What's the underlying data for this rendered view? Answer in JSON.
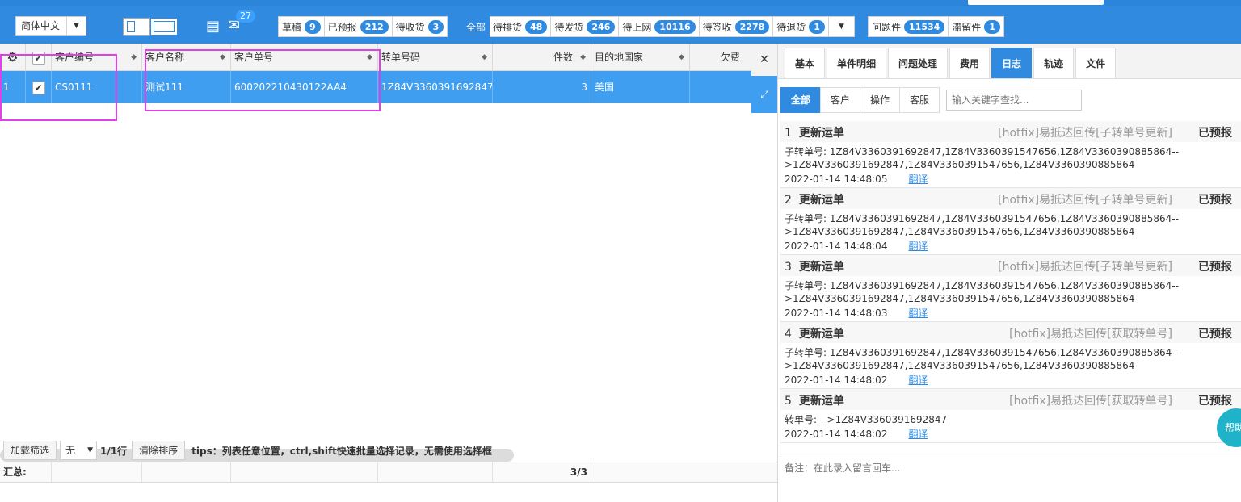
{
  "toolbar": {
    "language": "简体中文",
    "mail_count": "27",
    "group1": [
      {
        "label": "草稿",
        "count": "9"
      },
      {
        "label": "已预报",
        "count": "212"
      },
      {
        "label": "待收货",
        "count": "3"
      }
    ],
    "group2": [
      {
        "label": "全部",
        "count": ""
      },
      {
        "label": "待排货",
        "count": "48"
      },
      {
        "label": "待发货",
        "count": "246"
      },
      {
        "label": "待上网",
        "count": "10116"
      },
      {
        "label": "待签收",
        "count": "2278"
      },
      {
        "label": "待退货",
        "count": "1"
      }
    ],
    "group3": [
      {
        "label": "问题件",
        "count": "11534"
      },
      {
        "label": "滞留件",
        "count": "1"
      }
    ]
  },
  "grid": {
    "columns": [
      "客户编号",
      "客户名称",
      "客户单号",
      "转单号码",
      "件数",
      "目的地国家",
      "欠费"
    ],
    "row": {
      "index": "1",
      "customer_code": "CS0111",
      "customer_name": "测试111",
      "customer_order": "600202210430122AA4",
      "transfer_no": "1Z84V3360391692847",
      "pieces": "3",
      "country": "美国",
      "arrears": ""
    }
  },
  "bottom": {
    "load_filter": "加载筛选",
    "filter_value": "无",
    "row_count": "1/1行",
    "clear_sort": "清除排序",
    "tips": "tips：列表任意位置，ctrl,shift快速批量选择记录，无需使用选择框",
    "summary_label": "汇总:",
    "summary_pieces": "3/3"
  },
  "panel": {
    "tabs": [
      "基本",
      "单件明细",
      "问题处理",
      "费用",
      "日志",
      "轨迹",
      "文件"
    ],
    "active_tab": "日志",
    "subtabs": [
      "全部",
      "客户",
      "操作",
      "客服"
    ],
    "keyword_placeholder": "输入关键字查找...",
    "logs": [
      {
        "num": "1",
        "title": "更新运单",
        "op": "[hotfix]易抵达回传[子转单号更新]",
        "status": "已预报",
        "body": "子转单号: 1Z84V3360391692847,1Z84V3360391547656,1Z84V3360390885864-->1Z84V3360391692847,1Z84V3360391547656,1Z84V3360390885864",
        "time": "2022-01-14 14:48:05",
        "translate": "翻译"
      },
      {
        "num": "2",
        "title": "更新运单",
        "op": "[hotfix]易抵达回传[子转单号更新]",
        "status": "已预报",
        "body": "子转单号: 1Z84V3360391692847,1Z84V3360391547656,1Z84V3360390885864-->1Z84V3360391692847,1Z84V3360391547656,1Z84V3360390885864",
        "time": "2022-01-14 14:48:04",
        "translate": "翻译"
      },
      {
        "num": "3",
        "title": "更新运单",
        "op": "[hotfix]易抵达回传[子转单号更新]",
        "status": "已预报",
        "body": "子转单号: 1Z84V3360391692847,1Z84V3360391547656,1Z84V3360390885864-->1Z84V3360391692847,1Z84V3360391547656,1Z84V3360390885864",
        "time": "2022-01-14 14:48:03",
        "translate": "翻译"
      },
      {
        "num": "4",
        "title": "更新运单",
        "op": "[hotfix]易抵达回传[获取转单号]",
        "status": "已预报",
        "body": "子转单号: 1Z84V3360391692847,1Z84V3360391547656,1Z84V3360390885864-->1Z84V3360391692847,1Z84V3360391547656,1Z84V3360390885864",
        "time": "2022-01-14 14:48:02",
        "translate": "翻译"
      },
      {
        "num": "5",
        "title": "更新运单",
        "op": "[hotfix]易抵达回传[获取转单号]",
        "status": "已预报",
        "body": "转单号: -->1Z84V3360391692847",
        "time": "2022-01-14 14:48:02",
        "translate": "翻译"
      }
    ],
    "remark_placeholder": "备注：在此录入留言回车...",
    "help": "帮助"
  }
}
